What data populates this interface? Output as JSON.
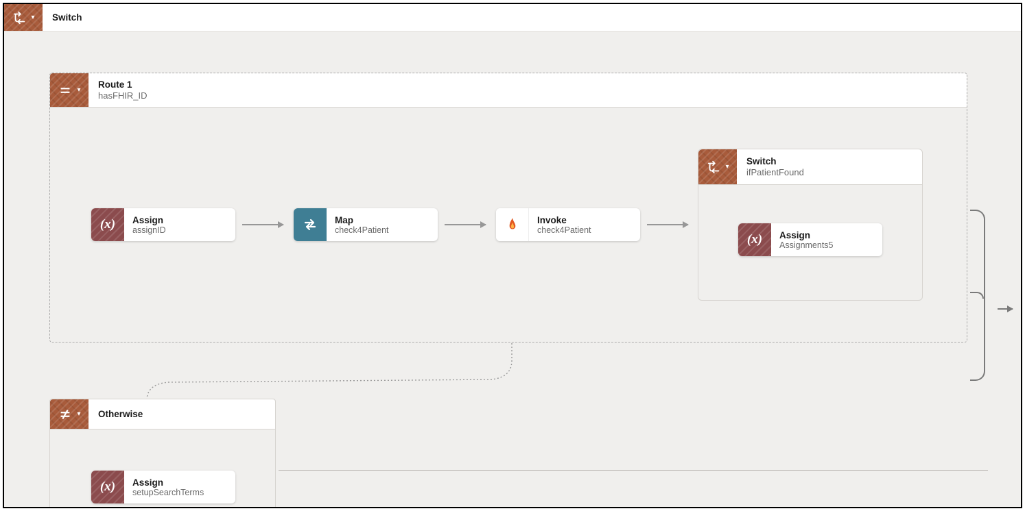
{
  "switch": {
    "title": "Switch"
  },
  "route1": {
    "title": "Route 1",
    "subtitle": "hasFHIR_ID",
    "nodes": {
      "assign": {
        "title": "Assign",
        "subtitle": "assignID"
      },
      "map": {
        "title": "Map",
        "subtitle": "check4Patient"
      },
      "invoke": {
        "title": "Invoke",
        "subtitle": "check4Patient"
      }
    },
    "innerSwitch": {
      "title": "Switch",
      "subtitle": "ifPatientFound",
      "assign": {
        "title": "Assign",
        "subtitle": "Assignments5"
      }
    }
  },
  "otherwise": {
    "title": "Otherwise",
    "assign": {
      "title": "Assign",
      "subtitle": "setupSearchTerms"
    }
  }
}
